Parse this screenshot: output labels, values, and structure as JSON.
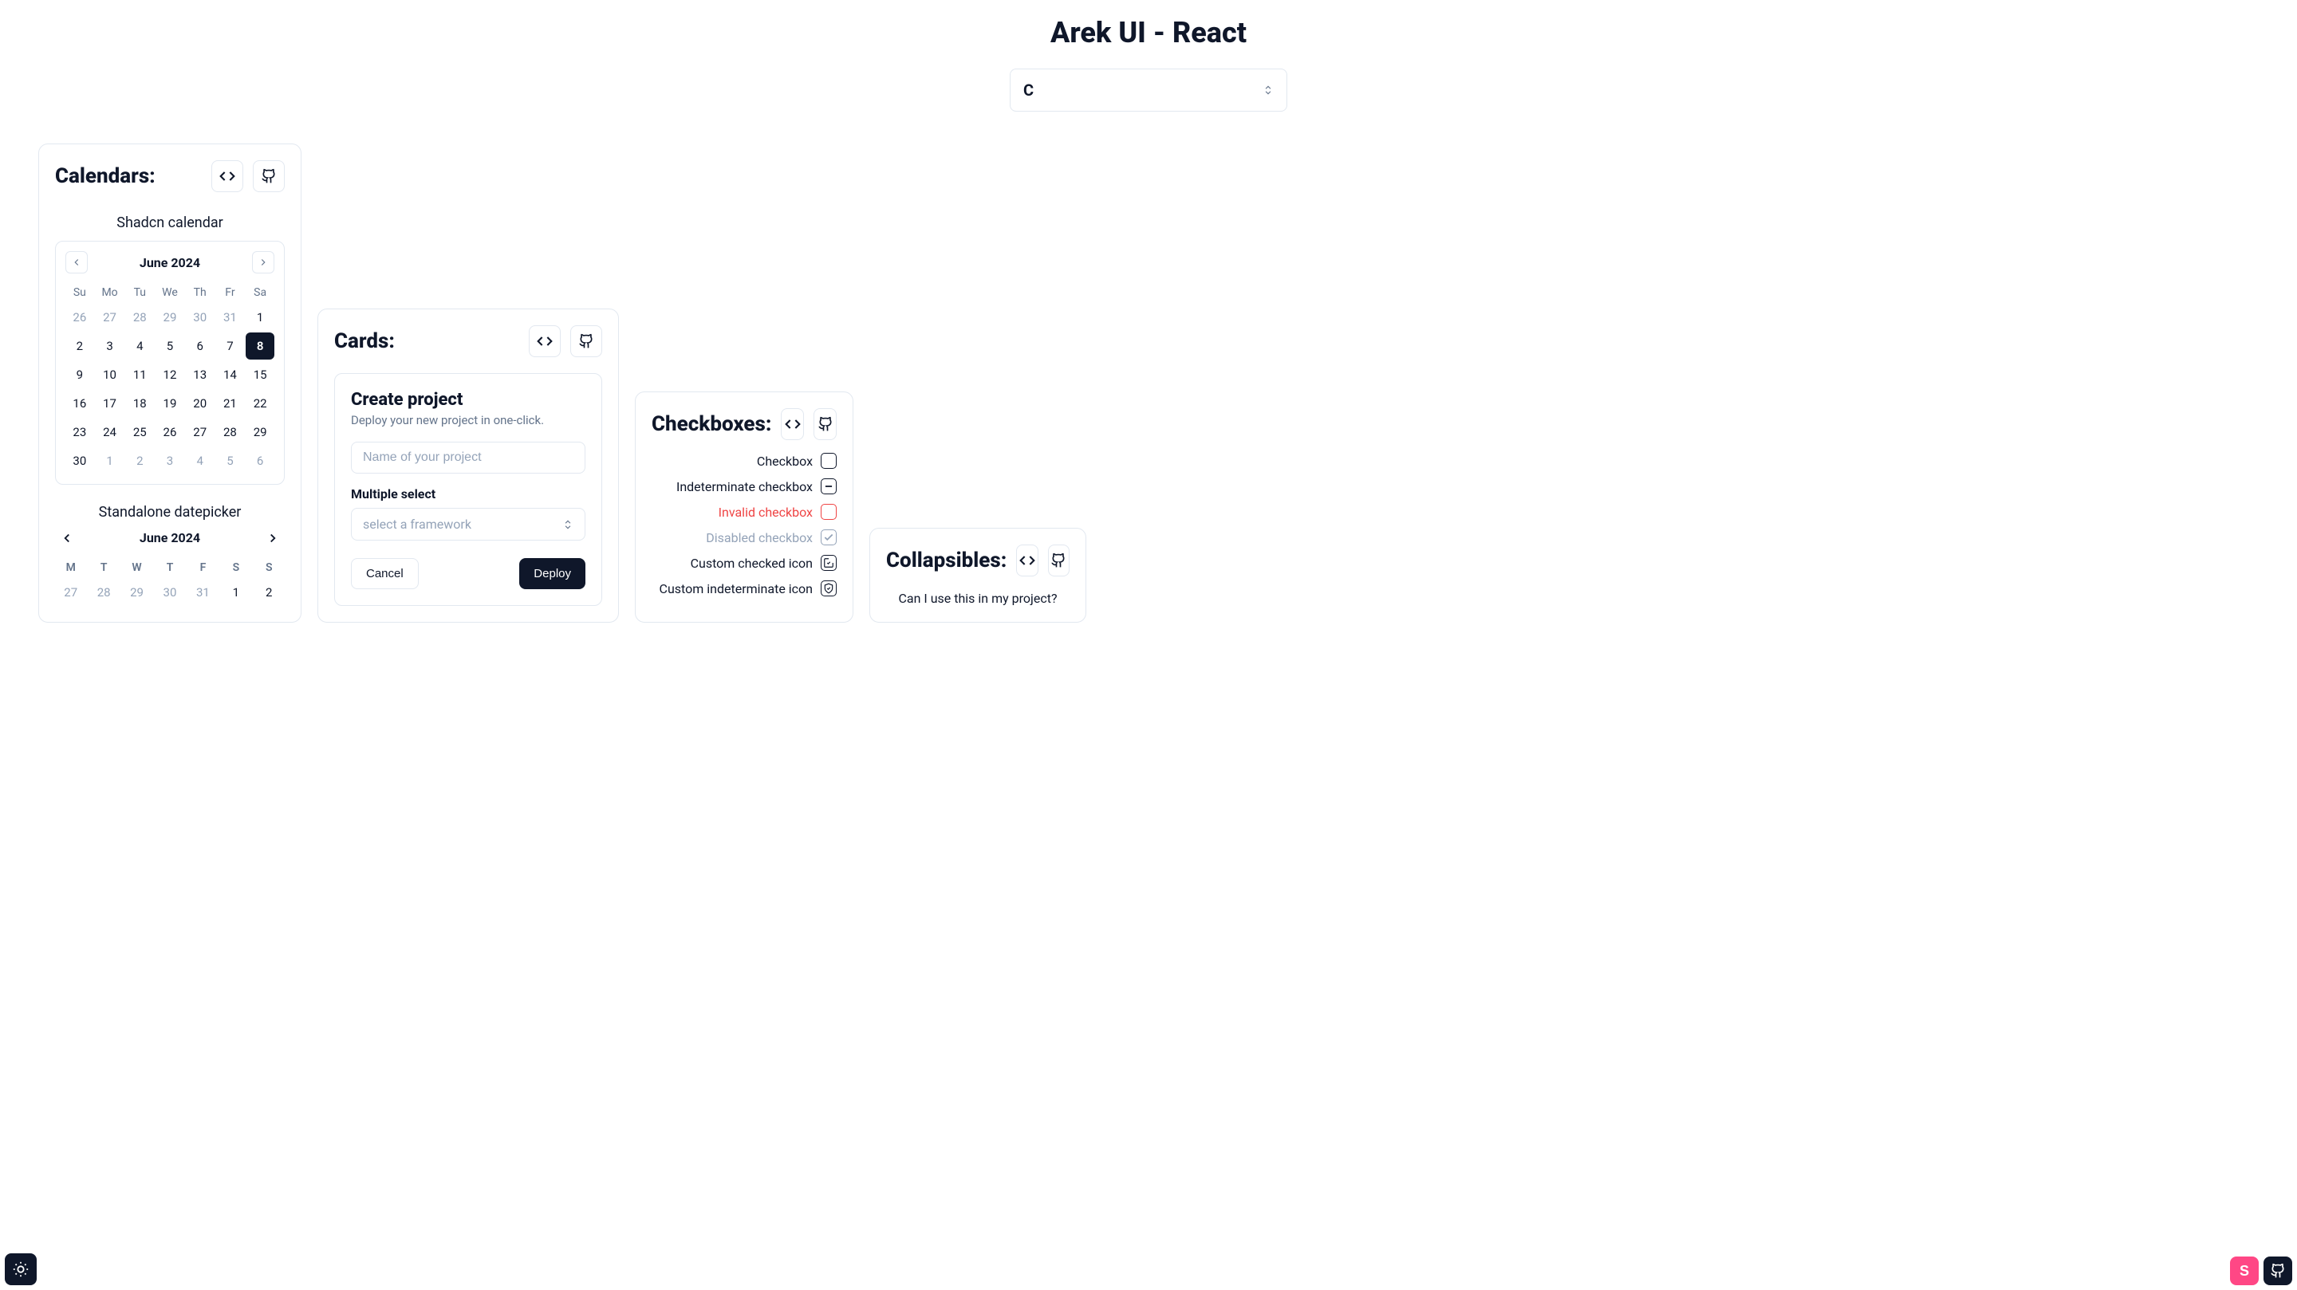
{
  "page": {
    "title": "Arek UI - React",
    "search_value": "C"
  },
  "calendars": {
    "title": "Calendars:",
    "shadcn_label": "Shadcn calendar",
    "month": "June 2024",
    "weekdays": [
      "Su",
      "Mo",
      "Tu",
      "We",
      "Th",
      "Fr",
      "Sa"
    ],
    "days": [
      {
        "n": "26",
        "m": true
      },
      {
        "n": "27",
        "m": true
      },
      {
        "n": "28",
        "m": true
      },
      {
        "n": "29",
        "m": true
      },
      {
        "n": "30",
        "m": true
      },
      {
        "n": "31",
        "m": true
      },
      {
        "n": "1"
      },
      {
        "n": "2"
      },
      {
        "n": "3"
      },
      {
        "n": "4"
      },
      {
        "n": "5"
      },
      {
        "n": "6"
      },
      {
        "n": "7"
      },
      {
        "n": "8",
        "sel": true
      },
      {
        "n": "9"
      },
      {
        "n": "10"
      },
      {
        "n": "11"
      },
      {
        "n": "12"
      },
      {
        "n": "13"
      },
      {
        "n": "14"
      },
      {
        "n": "15"
      },
      {
        "n": "16"
      },
      {
        "n": "17"
      },
      {
        "n": "18"
      },
      {
        "n": "19"
      },
      {
        "n": "20"
      },
      {
        "n": "21"
      },
      {
        "n": "22"
      },
      {
        "n": "23"
      },
      {
        "n": "24"
      },
      {
        "n": "25"
      },
      {
        "n": "26"
      },
      {
        "n": "27"
      },
      {
        "n": "28"
      },
      {
        "n": "29"
      },
      {
        "n": "30"
      },
      {
        "n": "1",
        "m": true
      },
      {
        "n": "2",
        "m": true
      },
      {
        "n": "3",
        "m": true
      },
      {
        "n": "4",
        "m": true
      },
      {
        "n": "5",
        "m": true
      },
      {
        "n": "6",
        "m": true
      }
    ],
    "standalone_label": "Standalone datepicker",
    "dp_month": "June 2024",
    "dp_weekdays": [
      "M",
      "T",
      "W",
      "T",
      "F",
      "S",
      "S"
    ],
    "dp_days": [
      {
        "n": "27",
        "m": true
      },
      {
        "n": "28",
        "m": true
      },
      {
        "n": "29",
        "m": true
      },
      {
        "n": "30",
        "m": true
      },
      {
        "n": "31",
        "m": true
      },
      {
        "n": "1"
      },
      {
        "n": "2"
      }
    ]
  },
  "cards": {
    "title": "Cards:",
    "create_title": "Create project",
    "create_sub": "Deploy your new project in one-click.",
    "name_placeholder": "Name of your project",
    "select_label": "Multiple select",
    "select_placeholder": "select a framework",
    "cancel": "Cancel",
    "deploy": "Deploy"
  },
  "checkboxes": {
    "title": "Checkboxes:",
    "items": [
      {
        "label": "Checkbox",
        "state": "empty"
      },
      {
        "label": "Indeterminate checkbox",
        "state": "indeterminate"
      },
      {
        "label": "Invalid checkbox",
        "state": "invalid"
      },
      {
        "label": "Disabled checkbox",
        "state": "disabled"
      },
      {
        "label": "Custom checked icon",
        "state": "custom-checked"
      },
      {
        "label": "Custom indeterminate icon",
        "state": "custom-indeterminate"
      }
    ]
  },
  "collapsibles": {
    "title": "Collapsibles:",
    "question": "Can I use this in my project?"
  }
}
